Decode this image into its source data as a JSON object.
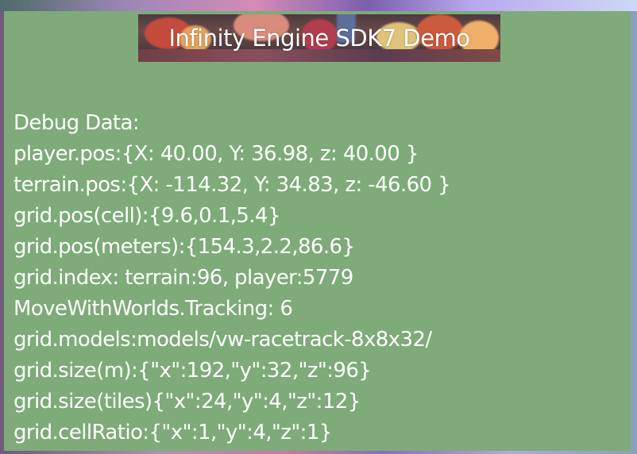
{
  "banner": {
    "title": "Infinity Engine SDK7 Demo"
  },
  "debug": {
    "header": "Debug Data:",
    "lines": [
      "player.pos:{X: 40.00, Y: 36.98, z: 40.00 }",
      "terrain.pos:{X: -114.32, Y: 34.83, z: -46.60 }",
      "grid.pos(cell):{9.6,0.1,5.4}",
      "grid.pos(meters):{154.3,2.2,86.6}",
      "grid.index: terrain:96, player:5779",
      "MoveWithWorlds.Tracking: 6",
      "grid.models:models/vw-racetrack-8x8x32/",
      "grid.size(m):{\"x\":192,\"y\":32,\"z\":96}",
      "grid.size(tiles){\"x\":24,\"y\":4,\"z\":12}",
      "grid.cellRatio:{\"x\":1,\"y\":4,\"z\":1}"
    ]
  },
  "colors": {
    "panel_background": "#7eab79",
    "text": "#ffffff"
  }
}
